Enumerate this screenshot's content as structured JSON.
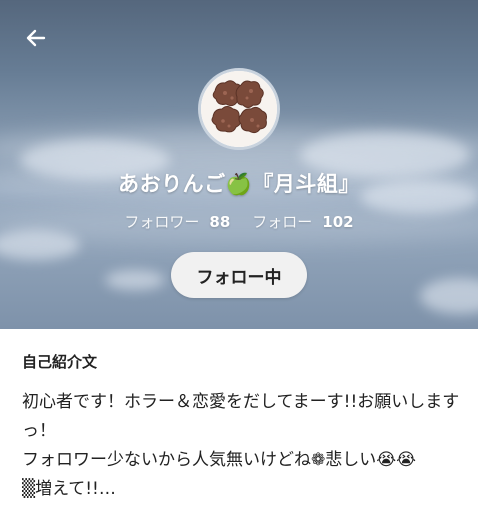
{
  "header": {
    "background_colors": [
      "#55677d",
      "#9badc2",
      "#7e92aa"
    ],
    "back_icon": "arrow-left-icon"
  },
  "profile": {
    "avatar_icon": "cookies-avatar",
    "display_name": "あおりんご🍏『月斗組』",
    "followers_label": "フォロワー",
    "followers_count": "88",
    "following_label": "フォロー",
    "following_count": "102",
    "follow_button_label": "フォロー中"
  },
  "bio": {
    "title": "自己紹介文",
    "text": "初心者です！ホラー＆恋愛をだしてまーす!!お願いしますっ！\nフォロワー少ないから人気無いけどね❁悲しい😭😭\n▒増えて!!…"
  }
}
